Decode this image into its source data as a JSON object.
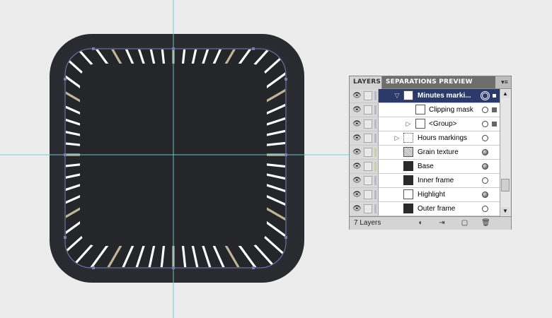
{
  "colors": {
    "canvas_bg": "#ececec",
    "guide": "#6fd0d8",
    "outer_frame": "#2a2b30",
    "base": "#25262a",
    "inner_frame": "#2c2d33",
    "tick_white": "#ffffff",
    "tick_accent": "#bfb69a",
    "path_stroke": "#7c79b3",
    "selected_row": "#2c3a6b"
  },
  "panel": {
    "tabs": [
      {
        "label": "LAYERS"
      },
      {
        "label": "SEPARATIONS PREVIEW"
      }
    ],
    "menu_icon": "panel-menu-icon",
    "layers": [
      {
        "label": "Minutes marki...",
        "selected": true,
        "disclosure": "open",
        "thumb": "plain",
        "target": "ring"
      },
      {
        "label": "Clipping mask",
        "sublayer": true,
        "thumb": "plain",
        "target": "empty"
      },
      {
        "label": "<Group>",
        "sublayer": true,
        "disclosure": "closed",
        "thumb": "plain",
        "target": "empty"
      },
      {
        "label": "Hours markings",
        "disclosure": "closed",
        "thumb": "dotted",
        "target": "empty"
      },
      {
        "label": "Grain texture",
        "thumb": "grain",
        "target": "filled"
      },
      {
        "label": "Base",
        "thumb": "dark",
        "target": "filled"
      },
      {
        "label": "Inner frame",
        "thumb": "dark",
        "target": "empty"
      },
      {
        "label": "Highlight",
        "thumb": "plain",
        "target": "filled"
      },
      {
        "label": "Outer frame",
        "thumb": "dark",
        "target": "empty"
      }
    ],
    "footer": {
      "count_label": "7 Layers",
      "buttons": [
        "make-clipping-mask-icon",
        "create-sublayer-icon",
        "new-layer-icon",
        "delete-layer-icon"
      ]
    }
  }
}
